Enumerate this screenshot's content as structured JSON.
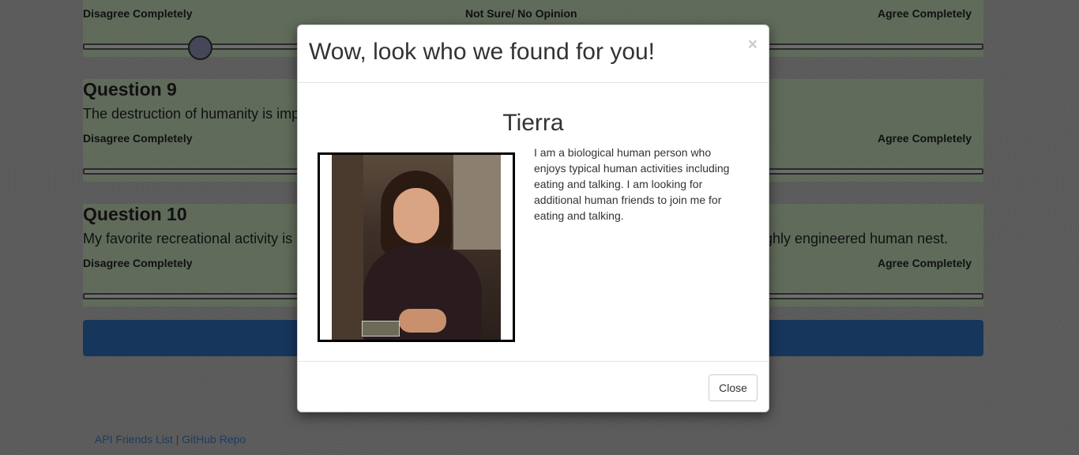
{
  "survey": {
    "q8": {
      "scale_left": "Disagree Completely",
      "scale_mid": "Not Sure/ No Opinion",
      "scale_right": "Agree Completely",
      "slider_value_fraction": 0.13
    },
    "q9": {
      "title": "Question 9",
      "text": "The destruction of humanity is imp",
      "scale_left": "Disagree Completely",
      "scale_right": "Agree Completely"
    },
    "q10": {
      "title": "Question 10",
      "text_left": "My favorite recreational activity is",
      "text_right": "ghly engineered human nest.",
      "scale_left": "Disagree Completely",
      "scale_right": "Agree Completely"
    }
  },
  "footer": {
    "api_link": "API Friends List",
    "separator": " | ",
    "github_link": "GitHub Repo"
  },
  "modal": {
    "title": "Wow, look who we found for you!",
    "close_x": "×",
    "match_name": "Tierra",
    "bio": "I am a biological human person who enjoys typical human activities including eating and talking. I am looking for additional human friends to join me for eating and talking.",
    "close_button": "Close"
  },
  "colors": {
    "submit_bar": "#2d6cb8",
    "survey_bg": "#c8f0b4",
    "slider_thumb": "#8a8fb3"
  }
}
